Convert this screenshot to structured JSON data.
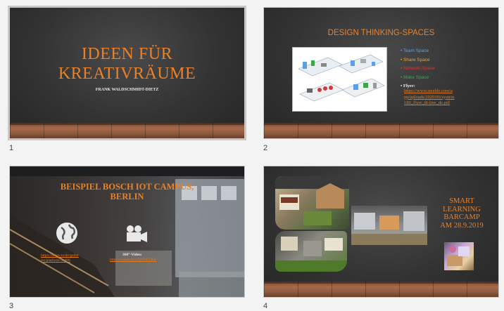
{
  "slides": [
    {
      "number": "1",
      "title_line1": "IDEEN FÜR",
      "title_line2": "KREATIVRÄUME",
      "author": "FRANK WALDSCHMIDT-DIETZ"
    },
    {
      "number": "2",
      "title": "DESIGN THINKING-SPACES",
      "bullets": [
        {
          "text": "Team Space",
          "color": "#5aa0e6"
        },
        {
          "text": "Share Space",
          "color": "#e6a040"
        },
        {
          "text": "Network-Space",
          "color": "#d03a3a"
        },
        {
          "text": "Make Space",
          "color": "#3aa84a"
        }
      ],
      "flyer_label": "Flyer:",
      "flyer_link_lines": [
        "https://www.steelde.com/a",
        "pp/uploads/2020/06/system",
        "180_flyer_dt-line_de.pdf"
      ]
    },
    {
      "number": "3",
      "title_line1": "BEISPIEL BOSCH IOT CAMPUS,",
      "title_line2": "BERLIN",
      "link_left_lines": [
        "https://moov.to/de/galler",
        "ies/platform-3ed06"
      ],
      "video_label": "360°-Video:",
      "video_link": "https://youtu.be/xQyr0rEJ3Oc"
    },
    {
      "number": "4",
      "title_lines": [
        "SMART",
        "LEARNING",
        "BARCAMP",
        "AM 28.9.2019"
      ]
    }
  ],
  "colors": {
    "accent": "#e8822a",
    "background": "#f3f3f3"
  },
  "icons": {
    "globe": "globe-icon",
    "camera": "video-camera-icon"
  }
}
